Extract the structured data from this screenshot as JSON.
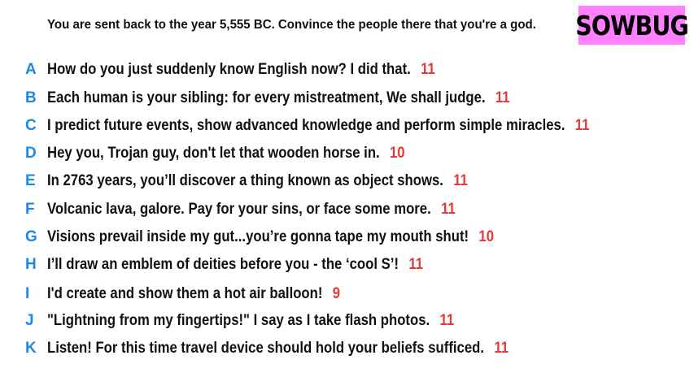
{
  "prompt": "You are sent back to the year 5,555 BC. Convince the people there that you're a god.",
  "logo": "SOWBUG",
  "colors": {
    "letter": "#1e88e5",
    "score": "#e53935",
    "logo_bg": "#ff80ff"
  },
  "answers": [
    {
      "letter": "A",
      "text": "How do you just suddenly know English now? I did that.",
      "score": "11"
    },
    {
      "letter": "B",
      "text": "Each human is your sibling: for every mistreatment, We shall judge.",
      "score": "11"
    },
    {
      "letter": "C",
      "text": "I predict future events, show advanced knowledge and perform simple miracles.",
      "score": "11"
    },
    {
      "letter": "D",
      "text": "Hey you, Trojan guy, don't let that wooden horse in.",
      "score": "10"
    },
    {
      "letter": "E",
      "text": "In 2763 years, you’ll discover a thing known as object shows.",
      "score": "11"
    },
    {
      "letter": "F",
      "text": "Volcanic lava, galore. Pay for your sins, or face some more.",
      "score": "11"
    },
    {
      "letter": "G",
      "text": "Visions prevail inside my gut...you’re gonna tape my mouth shut!",
      "score": "10"
    },
    {
      "letter": "H",
      "text": "I’ll draw an emblem of deities before you - the ‘cool S’!",
      "score": "11"
    },
    {
      "letter": "I",
      "text": "I'd create and show them a hot air balloon!",
      "score": "9"
    },
    {
      "letter": "J",
      "text": "\"Lightning from my fingertips!\" I say as I take flash photos.",
      "score": "11"
    },
    {
      "letter": "K",
      "text": "Listen! For this time travel device should hold your beliefs sufficed.",
      "score": "11"
    }
  ]
}
